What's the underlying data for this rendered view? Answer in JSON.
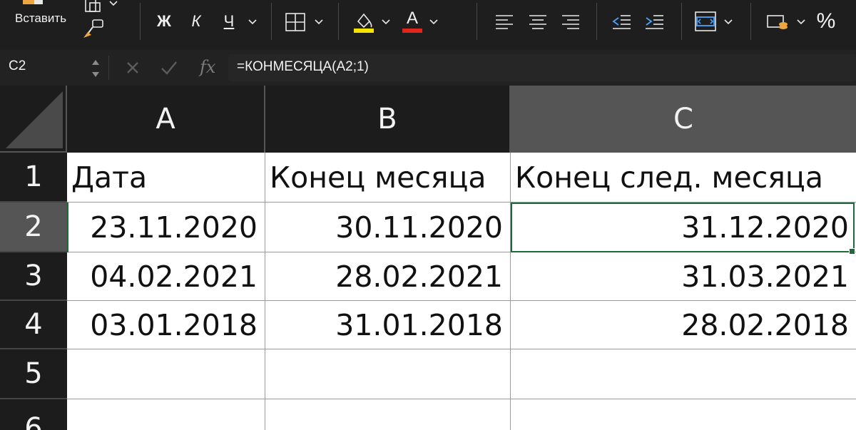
{
  "ribbon": {
    "paste_label": "Вставить",
    "bold_label": "Ж",
    "italic_label": "К",
    "underline_label": "Ч",
    "percent_label": "%",
    "font_color_label": "A",
    "accent_yellow": "#f5e400",
    "accent_red": "#e0261c",
    "accent_blue": "#4aa3ff"
  },
  "formula_bar": {
    "name_box": "C2",
    "fx": "fx",
    "formula": "=КОНМЕСЯЦА(A2;1)"
  },
  "sheet": {
    "columns": [
      "A",
      "B",
      "C"
    ],
    "rows": [
      "1",
      "2",
      "3",
      "4",
      "5",
      "6"
    ],
    "selected_cell": "C2",
    "cells": {
      "A1": "Дата",
      "B1": "Конец месяца",
      "C1": "Конец след. месяца",
      "A2": "23.11.2020",
      "B2": "30.11.2020",
      "C2": "31.12.2020",
      "A3": "04.02.2021",
      "B3": "28.02.2021",
      "C3": "31.03.2021",
      "A4": "03.01.2018",
      "B4": "31.01.2018",
      "C4": "28.02.2018"
    },
    "selection_color": "#1e6b3a"
  }
}
